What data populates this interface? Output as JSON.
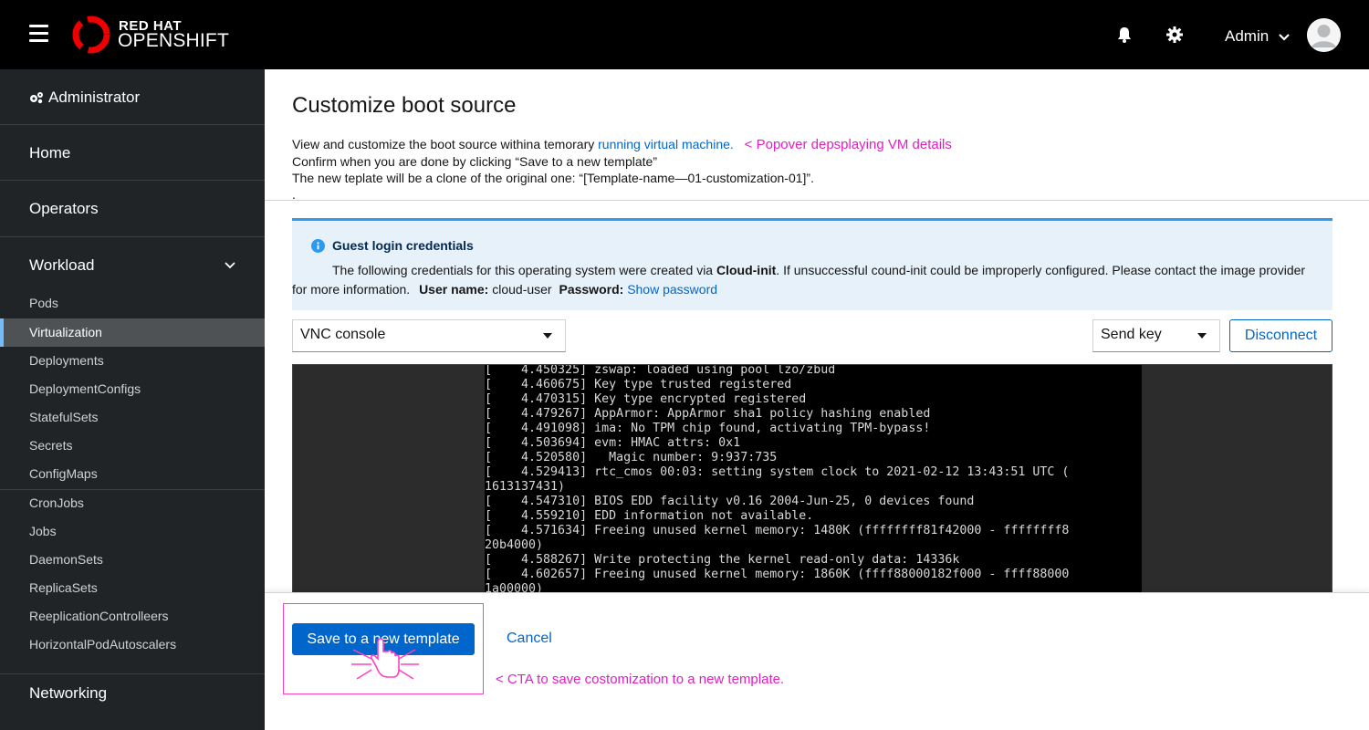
{
  "masthead": {
    "brand_line1": "RED HAT",
    "brand_line2": "OPENSHIFT",
    "user_label": "Admin",
    "icons": [
      "hamburger-icon",
      "bell-icon",
      "gear-icon",
      "chevron-down-icon",
      "avatar"
    ]
  },
  "sidebar": {
    "perspective": "Administrator",
    "sections": {
      "home": "Home",
      "operators": "Operators",
      "workload": "Workload",
      "networking": "Networking"
    },
    "workload_items": [
      {
        "label": "Pods"
      },
      {
        "label": "Virtualization",
        "active": true
      },
      {
        "label": "Deployments"
      },
      {
        "label": "DeploymentConfigs"
      },
      {
        "label": "StatefulSets"
      },
      {
        "label": "Secrets"
      },
      {
        "label": "ConfigMaps"
      },
      {
        "label": "CronJobs"
      },
      {
        "label": "Jobs"
      },
      {
        "label": "DaemonSets"
      },
      {
        "label": "ReplicaSets"
      },
      {
        "label": "ReeplicationControlleers"
      },
      {
        "label": "HorizontalPodAutoscalers"
      }
    ]
  },
  "page": {
    "title": "Customize boot source",
    "desc_line1_prefix": "View and customize the boot source withina temorary ",
    "desc_line1_link": "running virtual machine.",
    "desc_annotation": "< Popover depsplaying VM details",
    "desc_line2": "Confirm when you are done by clicking “Save to a new template”",
    "desc_line3": "The new teplate will be a clone of the original one: “[Template-name—01-customization-01]”.",
    "desc_line4": "."
  },
  "alert": {
    "title": "Guest login credentials",
    "body_prefix": "The following credentials for this operating system were created via ",
    "body_bold": "Cloud-init",
    "body_suffix": ". If unsuccessful cound-init could be improperly configured. Please contact the image provider",
    "body_line2": "for more information.",
    "username_label": "User name:",
    "username_value": "cloud-user",
    "password_label": "Password:",
    "password_link": "Show password"
  },
  "console_toolbar": {
    "console_type": "VNC console",
    "send_key": "Send key",
    "disconnect": "Disconnect"
  },
  "console_lines": [
    "[    4.450325] zswap: loaded using pool lzo/zbud",
    "[    4.460675] Key type trusted registered",
    "[    4.470315] Key type encrypted registered",
    "[    4.479267] AppArmor: AppArmor sha1 policy hashing enabled",
    "[    4.491098] ima: No TPM chip found, activating TPM-bypass!",
    "[    4.503694] evm: HMAC attrs: 0x1",
    "[    4.520580]   Magic number: 9:937:735",
    "[    4.529413] rtc_cmos 00:03: setting system clock to 2021-02-12 13:43:51 UTC (",
    "1613137431)",
    "[    4.547310] BIOS EDD facility v0.16 2004-Jun-25, 0 devices found",
    "[    4.559210] EDD information not available.",
    "[    4.571634] Freeing unused kernel memory: 1480K (ffffffff81f42000 - ffffffff8",
    "20b4000)",
    "[    4.588267] Write protecting the kernel read-only data: 14336k",
    "[    4.602657] Freeing unused kernel memory: 1860K (ffff88000182f000 - ffff88000",
    "1a00000)"
  ],
  "footer": {
    "save_label": "Save to a new template",
    "cancel_label": "Cancel",
    "annotation": "< CTA to save costomization to a new template."
  },
  "colors": {
    "masthead_bg": "#000000",
    "sidebar_bg": "#212427",
    "sidebar_active_bg": "#4f5255",
    "sidebar_active_accent": "#73bcf7",
    "primary": "#0066cc",
    "alert_bg": "#e7f1fa",
    "alert_border": "#2b9af3",
    "annotation": "#e020c0"
  }
}
